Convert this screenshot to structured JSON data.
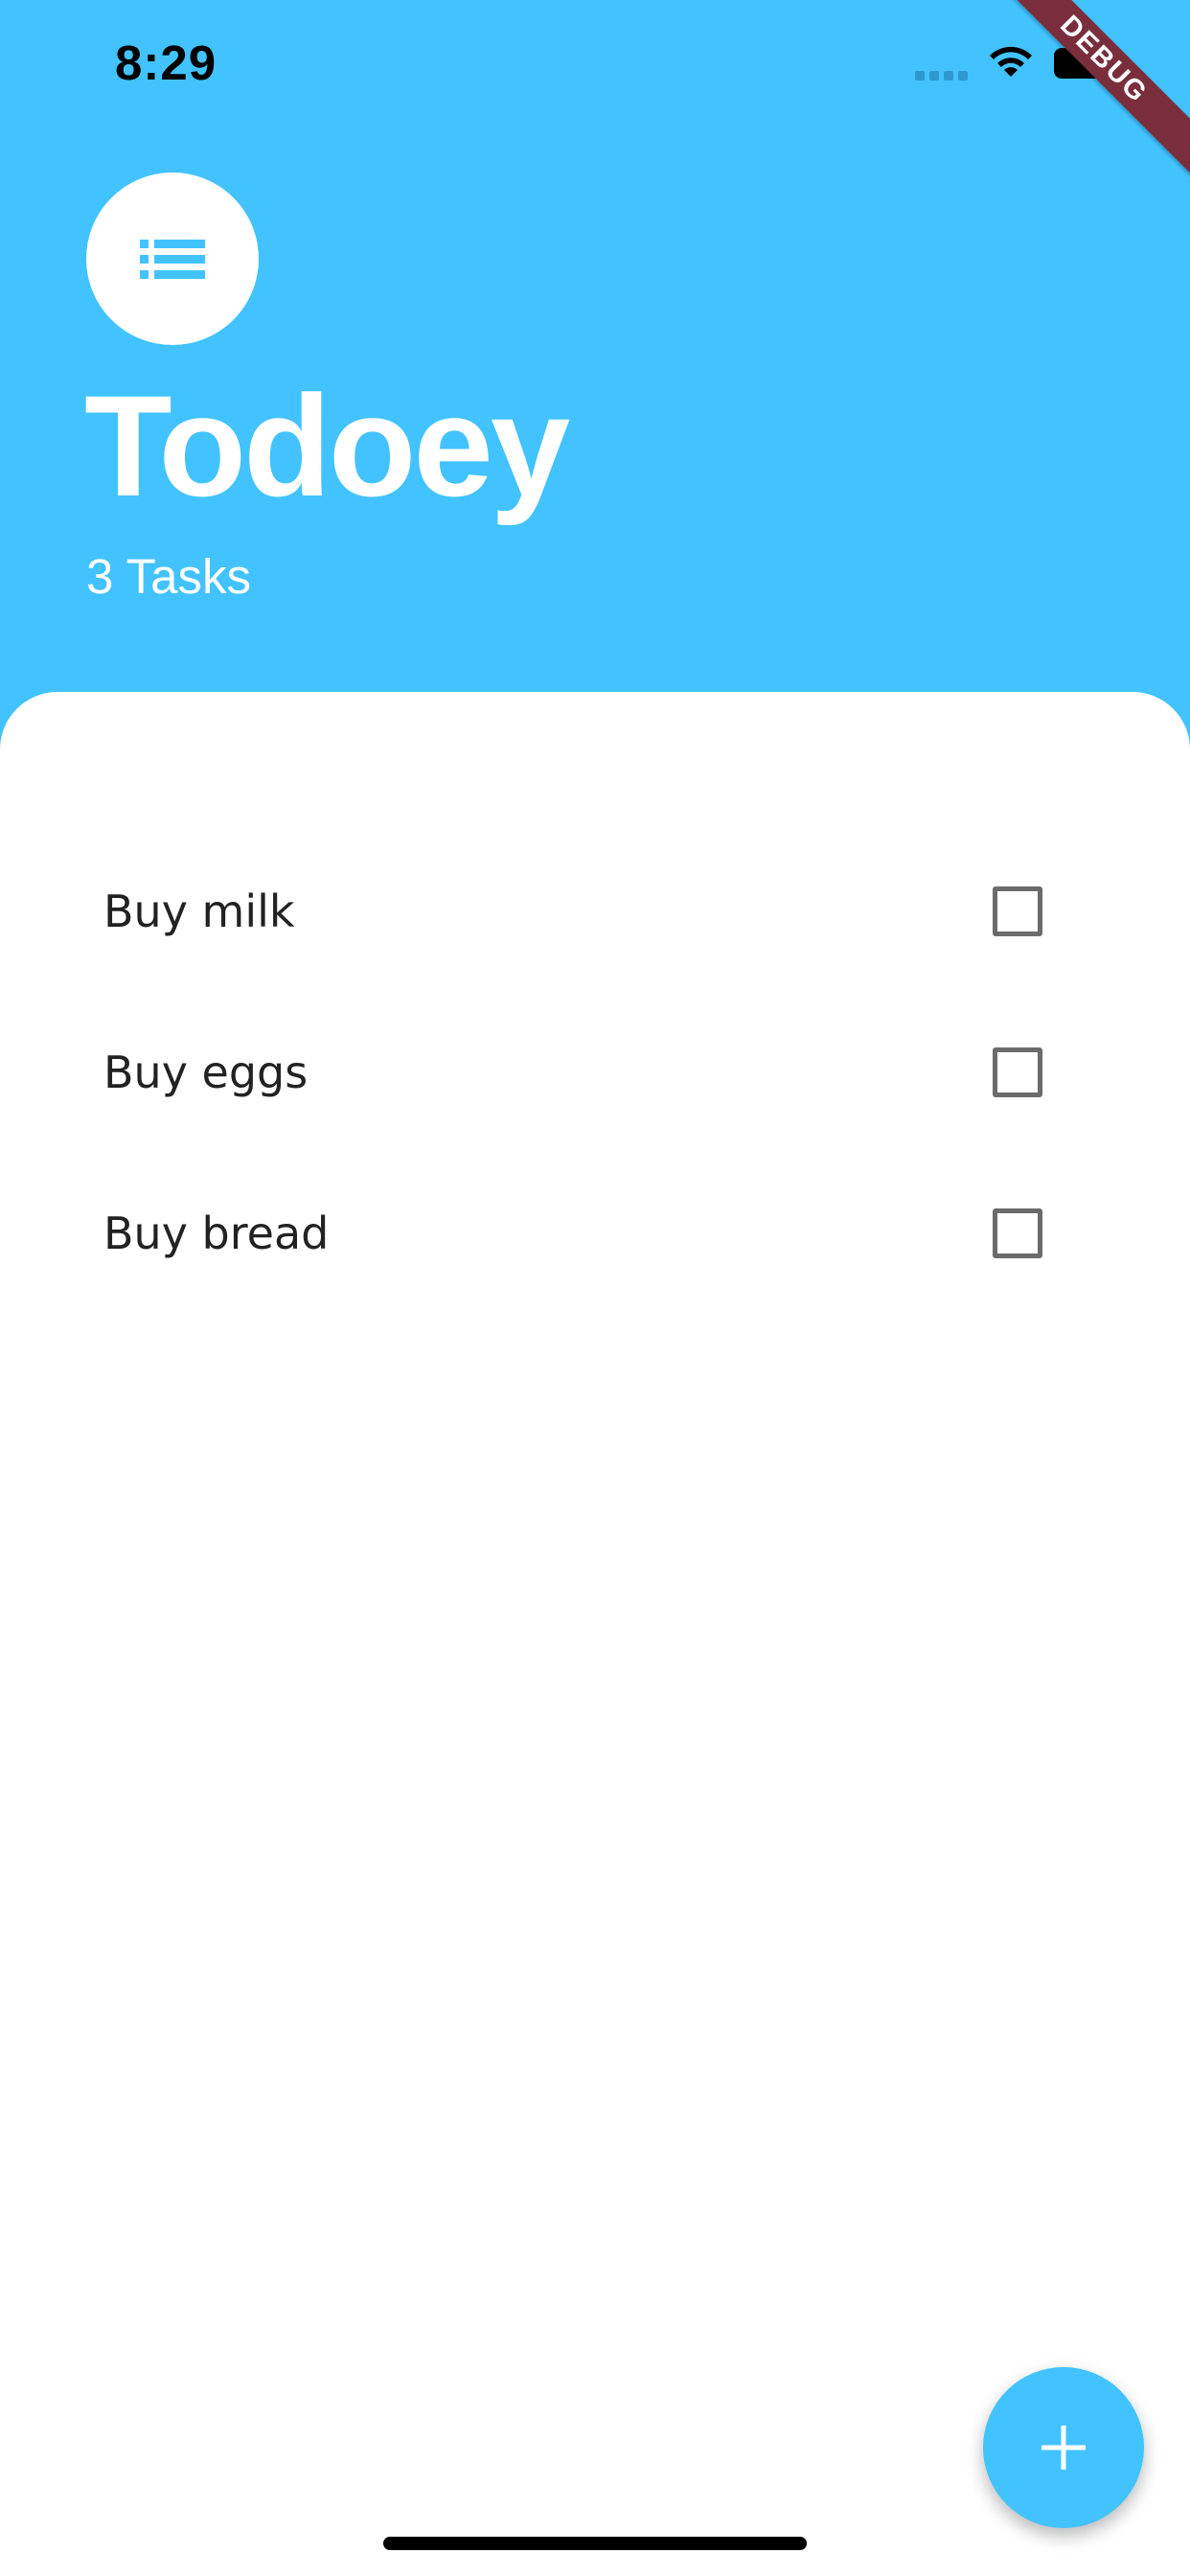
{
  "status_bar": {
    "time": "8:29",
    "icons": [
      "signal-icon",
      "wifi-icon",
      "battery-icon"
    ]
  },
  "debug_banner": {
    "label": "DEBUG"
  },
  "header": {
    "logo_icon": "list-icon",
    "title": "Todoey",
    "task_count": "3 Tasks"
  },
  "tasks": [
    {
      "label": "Buy milk",
      "checked": false
    },
    {
      "label": "Buy eggs",
      "checked": false
    },
    {
      "label": "Buy bread",
      "checked": false
    }
  ],
  "fab": {
    "icon": "plus-icon"
  },
  "colors": {
    "accent": "#42C3FF",
    "sheet": "#FFFFFF",
    "debug_banner": "#7A2E3C",
    "checkbox_border": "#6B6B6B"
  }
}
